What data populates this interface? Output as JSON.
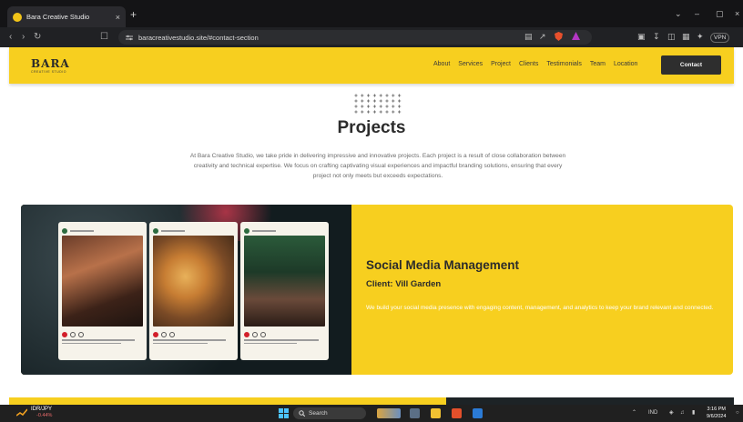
{
  "browser": {
    "tab_title": "Bara Creative Studio",
    "tab_close": "×",
    "new_tab": "+",
    "url": "baracreativestudio.site/#contact-section",
    "window_controls": [
      "⌄",
      "–",
      "▢",
      "×"
    ],
    "vpn_label": "VPN"
  },
  "header": {
    "logo": "BARA",
    "logo_sub": "CREATIVE STUDIO",
    "nav": [
      "About",
      "Services",
      "Project",
      "Clients",
      "Testimonials",
      "Team",
      "Location"
    ],
    "contact_label": "Contact",
    "bg_color": "#f7cf1f"
  },
  "section": {
    "title": "Projects",
    "description": "At Bara Creative Studio, we take pride in delivering impressive and innovative projects. Each project is a result of close collaboration between creativity and technical expertise. We focus on crafting captivating visual experiences and impactful branding solutions, ensuring that every project not only meets but exceeds expectations."
  },
  "project": {
    "title": "Social Media Management",
    "client": "Client: Vill Garden",
    "description": "We build your social media presence with engaging content, management, and analytics to keep your brand relevant and connected."
  },
  "taskbar": {
    "ticker": "IDR/JPY",
    "ticker_change": "-0.44%",
    "search_label": "Search",
    "lang": "IND",
    "time": "3:16 PM",
    "date": "9/6/2024"
  }
}
